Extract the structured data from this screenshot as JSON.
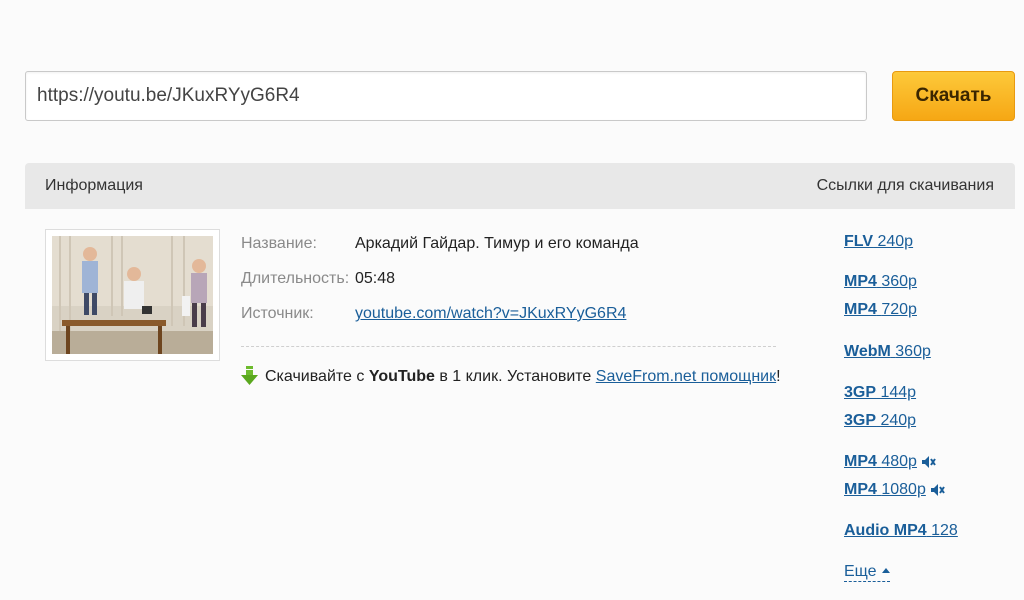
{
  "search": {
    "url_value": "https://youtu.be/JKuxRYyG6R4",
    "download_label": "Скачать"
  },
  "panel": {
    "info_header": "Информация",
    "links_header": "Ссылки для скачивания"
  },
  "video": {
    "title_label": "Название:",
    "title": "Аркадий Гайдар. Тимур и его команда",
    "duration_label": "Длительность:",
    "duration": "05:48",
    "source_label": "Источник:",
    "source": "youtube.com/watch?v=JKuxRYyG6R4"
  },
  "promo": {
    "part1": "Скачивайте с ",
    "brand": "YouTube",
    "part2": " в 1 клик. Установите ",
    "link": "SaveFrom.net помощник",
    "end": "!"
  },
  "downloads": [
    {
      "format": "FLV",
      "quality": "240p",
      "muted": false
    },
    {
      "format": "MP4",
      "quality": "360p",
      "muted": false
    },
    {
      "format": "MP4",
      "quality": "720p",
      "muted": false
    },
    {
      "format": "WebM",
      "quality": "360p",
      "muted": false
    },
    {
      "format": "3GP",
      "quality": "144p",
      "muted": false
    },
    {
      "format": "3GP",
      "quality": "240p",
      "muted": false
    },
    {
      "format": "MP4",
      "quality": "480p",
      "muted": true
    },
    {
      "format": "MP4",
      "quality": "1080p",
      "muted": true
    },
    {
      "format": "Audio MP4",
      "quality": "128",
      "muted": false
    }
  ],
  "more_label": "Еще",
  "colors": {
    "accent": "#f6a714",
    "link": "#1a5e99",
    "header_bg": "#e8e8e8"
  },
  "icons": {
    "promo_arrow": "green-down-arrow-icon",
    "mute": "mute-icon",
    "more_caret": "caret-up-icon"
  }
}
